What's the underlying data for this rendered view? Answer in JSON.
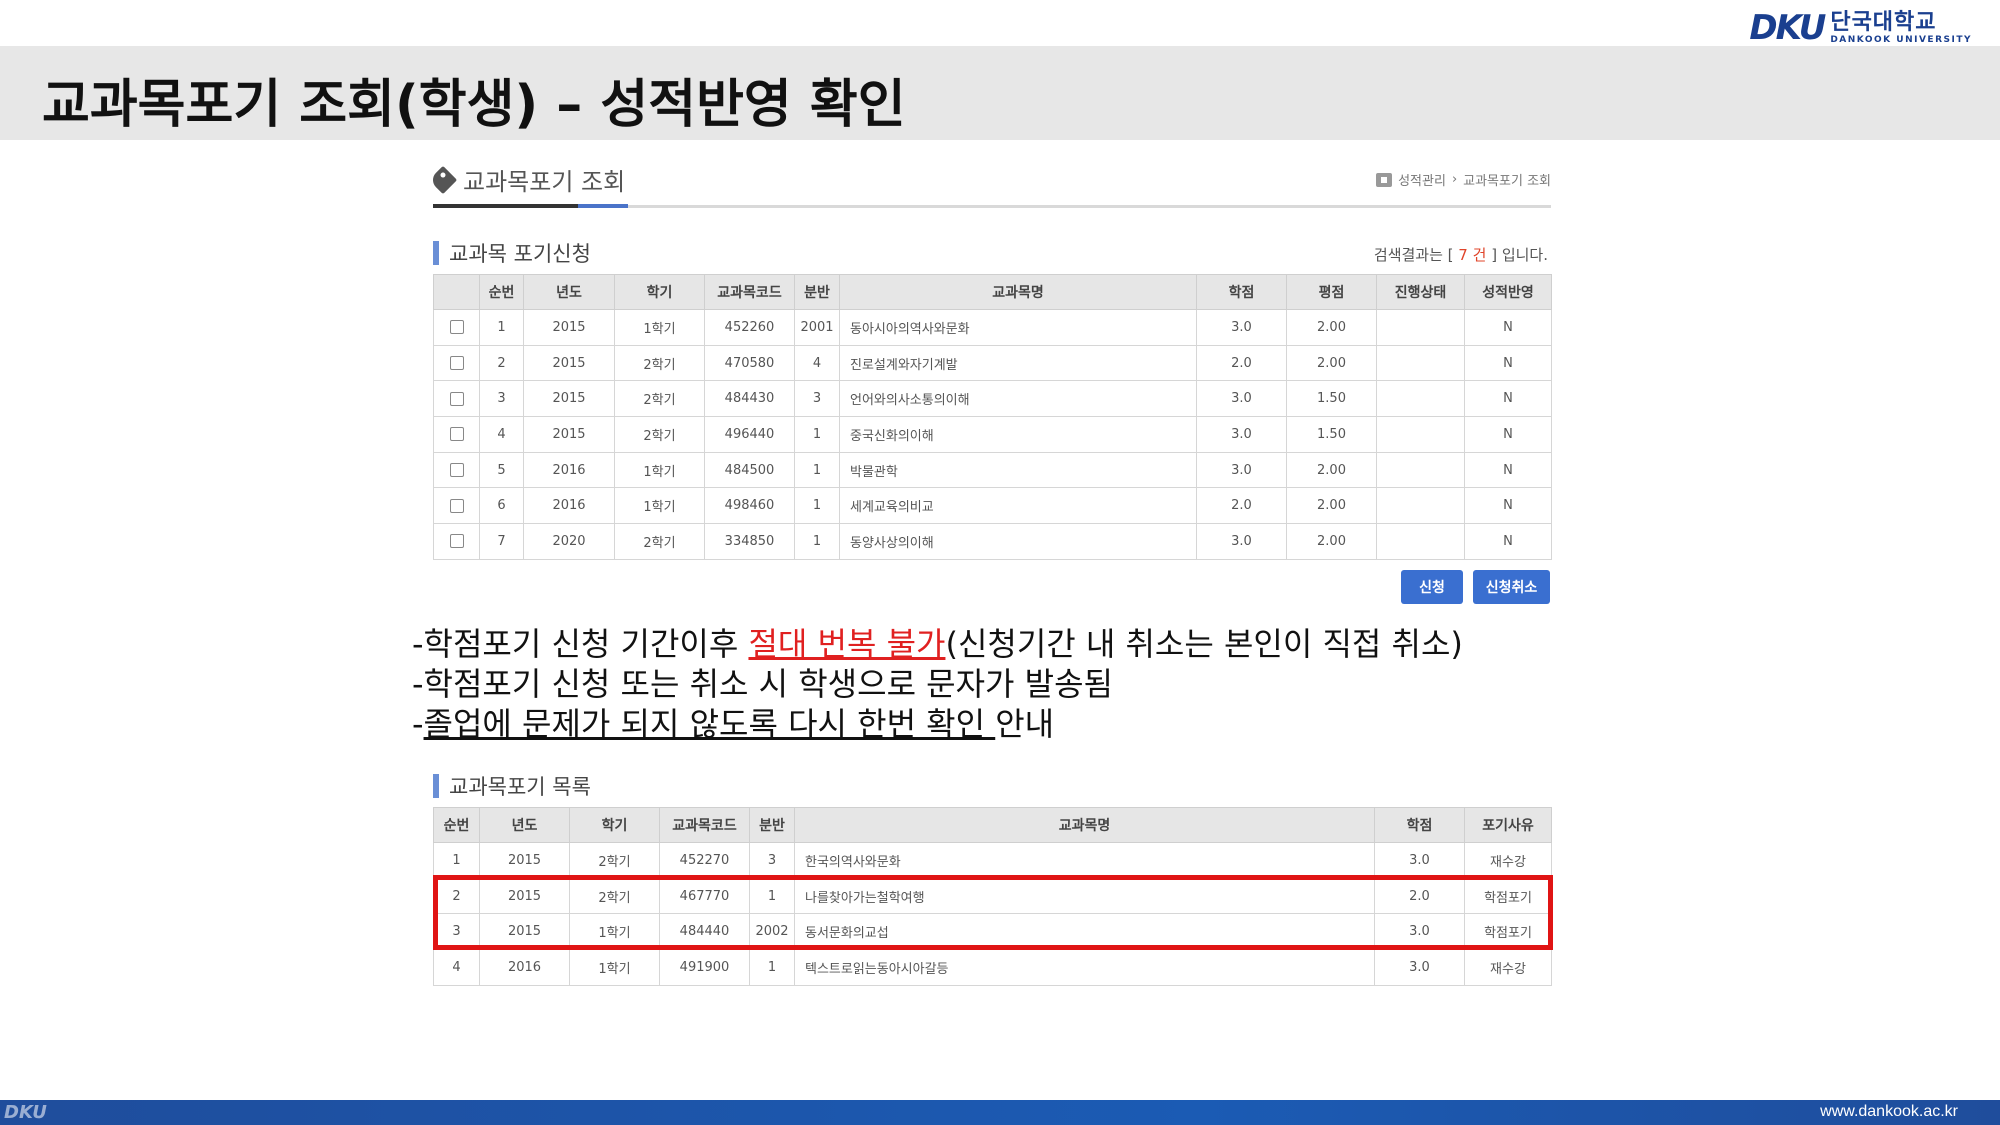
{
  "slide": {
    "title": "교과목포기 조회(학생) – 성적반영 확인",
    "logo_mark": "DKU",
    "logo_kr": "단국대학교",
    "logo_en": "DANKOOK UNIVERSITY",
    "footer_url": "www.dankook.ac.kr",
    "footer_deco": "DKU"
  },
  "page": {
    "title": "교과목포기 조회",
    "title_icon": "tag-icon",
    "breadcrumb": [
      "성적관리",
      "교과목포기 조회"
    ],
    "breadcrumb_sep": "›"
  },
  "apply_section": {
    "heading": "교과목 포기신청",
    "result_prefix": "검색결과는 [",
    "result_count": "7 건",
    "result_suffix": "] 입니다.",
    "columns": [
      "",
      "순번",
      "년도",
      "학기",
      "교과목코드",
      "분반",
      "교과목명",
      "학점",
      "평점",
      "진행상태",
      "성적반영"
    ],
    "rows": [
      {
        "no": "1",
        "year": "2015",
        "term": "1학기",
        "code": "452260",
        "sec": "2001",
        "name": "동아시아의역사와문화",
        "credit": "3.0",
        "grade": "2.00",
        "status": "",
        "reflect": "N"
      },
      {
        "no": "2",
        "year": "2015",
        "term": "2학기",
        "code": "470580",
        "sec": "4",
        "name": "진로설계와자기계발",
        "credit": "2.0",
        "grade": "2.00",
        "status": "",
        "reflect": "N"
      },
      {
        "no": "3",
        "year": "2015",
        "term": "2학기",
        "code": "484430",
        "sec": "3",
        "name": "언어와의사소통의이해",
        "credit": "3.0",
        "grade": "1.50",
        "status": "",
        "reflect": "N"
      },
      {
        "no": "4",
        "year": "2015",
        "term": "2학기",
        "code": "496440",
        "sec": "1",
        "name": "중국신화의이해",
        "credit": "3.0",
        "grade": "1.50",
        "status": "",
        "reflect": "N"
      },
      {
        "no": "5",
        "year": "2016",
        "term": "1학기",
        "code": "484500",
        "sec": "1",
        "name": "박물관학",
        "credit": "3.0",
        "grade": "2.00",
        "status": "",
        "reflect": "N"
      },
      {
        "no": "6",
        "year": "2016",
        "term": "1학기",
        "code": "498460",
        "sec": "1",
        "name": "세계교육의비교",
        "credit": "2.0",
        "grade": "2.00",
        "status": "",
        "reflect": "N"
      },
      {
        "no": "7",
        "year": "2020",
        "term": "2학기",
        "code": "334850",
        "sec": "1",
        "name": "동양사상의이해",
        "credit": "3.0",
        "grade": "2.00",
        "status": "",
        "reflect": "N"
      }
    ],
    "apply_button": "신청",
    "cancel_button": "신청취소"
  },
  "notes": {
    "line1_a": "-학점포기 신청 기간이후 ",
    "line1_red": "절대 번복 불가",
    "line1_b": "(신청기간 내 취소는 본인이 직접 취소)",
    "line2": "-학점포기 신청 또는 취소 시 학생으로 문자가 발송됨",
    "line3_a": "-",
    "line3_ul": "졸업에 문제가 되지 않도록 다시 한번 확인 ",
    "line3_b": "안내"
  },
  "list_section": {
    "heading": "교과목포기 목록",
    "columns": [
      "순번",
      "년도",
      "학기",
      "교과목코드",
      "분반",
      "교과목명",
      "학점",
      "포기사유"
    ],
    "rows": [
      {
        "no": "1",
        "year": "2015",
        "term": "2학기",
        "code": "452270",
        "sec": "3",
        "name": "한국의역사와문화",
        "credit": "3.0",
        "reason": "재수강"
      },
      {
        "no": "2",
        "year": "2015",
        "term": "2학기",
        "code": "467770",
        "sec": "1",
        "name": "나를찾아가는철학여행",
        "credit": "2.0",
        "reason": "학점포기"
      },
      {
        "no": "3",
        "year": "2015",
        "term": "1학기",
        "code": "484440",
        "sec": "2002",
        "name": "동서문화의교섭",
        "credit": "3.0",
        "reason": "학점포기"
      },
      {
        "no": "4",
        "year": "2016",
        "term": "1학기",
        "code": "491900",
        "sec": "1",
        "name": "텍스트로읽는동아시아갈등",
        "credit": "3.0",
        "reason": "재수강"
      }
    ]
  },
  "colors": {
    "accent_blue": "#3a6fd0",
    "highlight_red": "#e01414",
    "footer_blue": "#1b5bb4"
  }
}
